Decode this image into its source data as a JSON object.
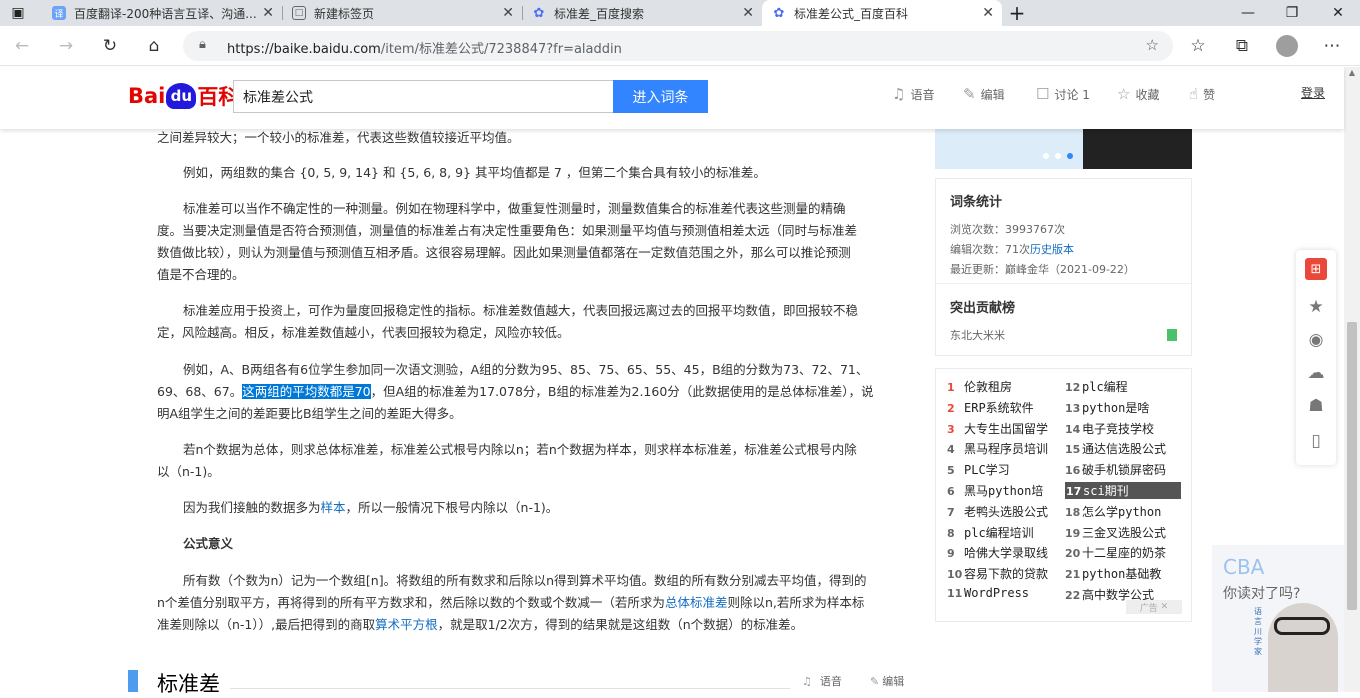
{
  "browser": {
    "tabs": [
      {
        "title": "百度翻译-200种语言互译、沟通...",
        "active": false
      },
      {
        "title": "新建标签页",
        "active": false
      },
      {
        "title": "标准差_百度搜索",
        "active": false
      },
      {
        "title": "标准差公式_百度百科",
        "active": true
      }
    ],
    "url_prefix": "https://baike.baidu.com",
    "url_rest": "/item/标准差公式/7238847?fr=aladdin"
  },
  "header": {
    "logo_text_1": "Bai",
    "logo_text_2": "du",
    "logo_text_3": "百科",
    "search_value": "标准差公式",
    "search_button": "进入词条",
    "tools": [
      "语音",
      "编辑",
      "讨论 1",
      "收藏",
      "赞"
    ],
    "login": "登录"
  },
  "content": {
    "p0": "之间差异较大；一个较小的标准差，代表这些数值较接近平均值。",
    "p1": "例如，两组数的集合 {0, 5, 9, 14} 和 {5, 6, 8, 9} 其平均值都是 7 ，但第二个集合具有较小的标准差。",
    "p2_line1": "标准差可以当作不确定性的一种测量。例如在物理科学中，做重复性测量时，测量数值集合的标准差代表这些测量的精确",
    "p2_line2": "度。当要决定测量值是否符合预测值，测量值的标准差占有决定性重要角色：如果测量平均值与预测值相差太远（同时与标准差",
    "p2_line3": "数值做比较），则认为测量值与预测值互相矛盾。这很容易理解。因此如果测量值都落在一定数值范围之外，那么可以推论预测",
    "p2_line4": "值是不合理的。",
    "p3_line1": "标准差应用于投资上，可作为量度回报稳定性的指标。标准差数值越大，代表回报远离过去的回报平均数值，即回报较不稳",
    "p3_line2": "定，风险越高。相反，标准差数值越小，代表回报较为稳定，风险亦较低。",
    "p4_line1": "例如，A、B两组各有6位学生参加同一次语文测验，A组的分数为95、85、75、65、55、45，B组的分数为73、72、71、",
    "p4_line2_a": "69、68、67。",
    "p4_line2_hl": "这两组的平均数都是70",
    "p4_line2_b": "，但A组的标准差为17.078分，B组的标准差为2.160分（此数据使用的是总体标准差），说",
    "p4_line3": "明A组学生之间的差距要比B组学生之间的差距大得多。",
    "p5_line1": "若n个数据为总体，则求总体标准差，标准差公式根号内除以n；若n个数据为样本，则求样本标准差，标准差公式根号内除",
    "p5_line2": "以（n-1)。",
    "p6_a": "因为我们接触的数据多为",
    "p6_link": "样本",
    "p6_b": "，所以一般情况下根号内除以（n-1)。",
    "subhead": "公式意义",
    "p7_line1": "所有数（个数为n）记为一个数组[n]。将数组的所有数求和后除以n得到算术平均值。数组的所有数分别减去平均值，得到的",
    "p7_line2_a": "n个差值分别取平方，再将得到的所有平方数求和，然后除以数的个数或个数减一（若所求为",
    "p7_line2_link": "总体标准差",
    "p7_line2_b": "则除以n,若所求为样本标",
    "p7_line3_a": "准差则除以（n-1））,最后把得到的商取",
    "p7_line3_link": "算术平方根",
    "p7_line3_b": "，就是取1/2次方，得到的结果就是这组数（n个数据）的标准差。",
    "section_title": "标准差",
    "section_tools": [
      "语音",
      "编辑"
    ]
  },
  "sidebar": {
    "stats_title": "词条统计",
    "views_label": "浏览次数：",
    "views_value": "3993767次",
    "edits_label": "编辑次数：",
    "edits_value": "71次",
    "edits_link": "历史版本",
    "updated_label": "最近更新：",
    "updated_value": "巅峰金华（2021-09-22）",
    "contrib_title": "突出贡献榜",
    "contrib_name": "东北大米米",
    "hot_left": [
      {
        "n": "1",
        "t": "伦敦租房"
      },
      {
        "n": "2",
        "t": "ERP系统软件"
      },
      {
        "n": "3",
        "t": "大专生出国留学"
      },
      {
        "n": "4",
        "t": "黑马程序员培训"
      },
      {
        "n": "5",
        "t": "PLC学习"
      },
      {
        "n": "6",
        "t": "黑马python培"
      },
      {
        "n": "7",
        "t": "老鸭头选股公式"
      },
      {
        "n": "8",
        "t": "plc编程培训"
      },
      {
        "n": "9",
        "t": "哈佛大学录取线"
      },
      {
        "n": "10",
        "t": "容易下款的贷款"
      },
      {
        "n": "11",
        "t": "WordPress"
      }
    ],
    "hot_right": [
      {
        "n": "12",
        "t": "plc编程"
      },
      {
        "n": "13",
        "t": "python是啥"
      },
      {
        "n": "14",
        "t": "电子竞技学校"
      },
      {
        "n": "15",
        "t": "通达信选股公式"
      },
      {
        "n": "16",
        "t": "破手机锁屏密码"
      },
      {
        "n": "17",
        "t": "sci期刊"
      },
      {
        "n": "18",
        "t": "怎么学python"
      },
      {
        "n": "19",
        "t": "三金叉选股公式"
      },
      {
        "n": "20",
        "t": "十二星座的奶茶"
      },
      {
        "n": "21",
        "t": "python基础教"
      },
      {
        "n": "22",
        "t": "高中数学公式"
      }
    ],
    "ad_tag": "广告"
  },
  "video_ad": {
    "line1": "CBA",
    "line2": "你读对了吗?",
    "brand": "语言川学家"
  },
  "colors": {
    "accent": "#3385ff",
    "link": "#136ec2",
    "selection": "#0078d7",
    "rank_red": "#e9483b"
  }
}
